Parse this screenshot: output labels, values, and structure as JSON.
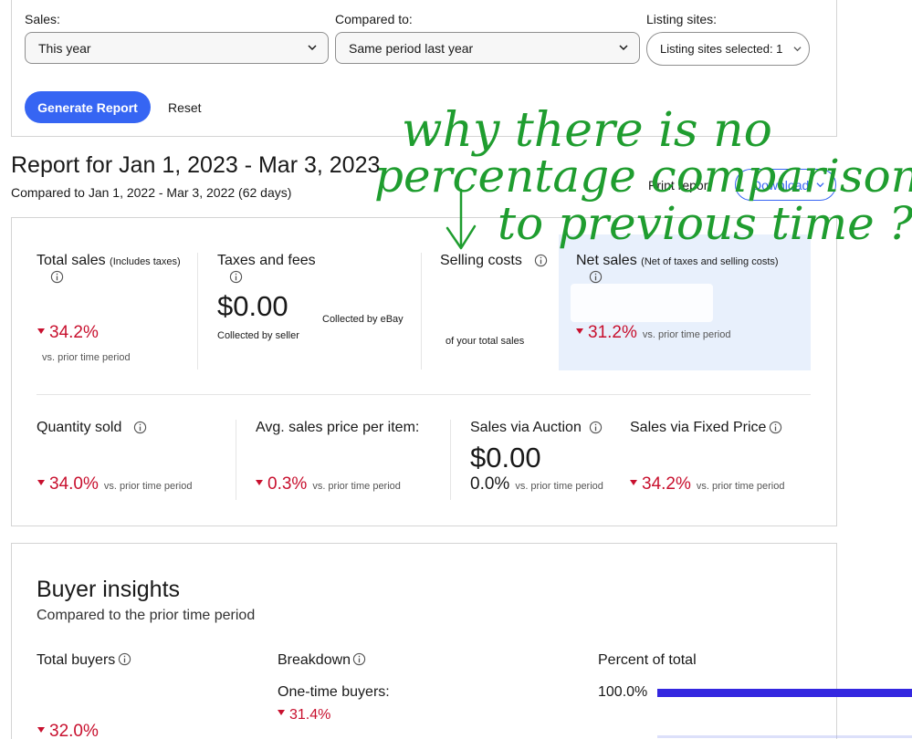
{
  "filters": {
    "sales_label": "Sales:",
    "sales_value": "This year",
    "compared_label": "Compared to:",
    "compared_value": "Same period last year",
    "sites_label": "Listing sites:",
    "sites_value": "Listing sites selected: 1",
    "generate_label": "Generate Report",
    "reset_label": "Reset"
  },
  "report": {
    "title": "Report for Jan 1, 2023 - Mar 3, 2023",
    "compared": "Compared to Jan 1, 2022 - Mar 3, 2022 (62 days)",
    "print_label": "Print report",
    "download_label": "Download"
  },
  "summary": {
    "total_sales": {
      "title": "Total sales",
      "note": "(Includes taxes)",
      "change": "34.2%",
      "vs": "vs. prior time period"
    },
    "taxes": {
      "title": "Taxes and fees",
      "value": "$0.00",
      "collected_ebay": "Collected by eBay",
      "collected_seller": "Collected by seller"
    },
    "selling_costs": {
      "title": "Selling costs",
      "of_total": "of your total sales"
    },
    "net_sales": {
      "title": "Net sales",
      "note": "(Net of taxes and selling costs)",
      "change": "31.2%",
      "vs": "vs. prior time period"
    }
  },
  "secondary": {
    "quantity": {
      "title": "Quantity sold",
      "change": "34.0%",
      "vs": "vs. prior time period"
    },
    "avg_price": {
      "title": "Avg. sales price per item:",
      "change": "0.3%",
      "vs": "vs. prior time period"
    },
    "auction": {
      "title": "Sales via Auction",
      "value": "$0.00",
      "change": "0.0%",
      "vs": "vs. prior time period"
    },
    "fixed": {
      "title": "Sales via Fixed Price",
      "change": "34.2%",
      "vs": "vs. prior time period"
    }
  },
  "buyers": {
    "title": "Buyer insights",
    "subtitle": "Compared to the prior time period",
    "total_buyers": "Total buyers",
    "total_change": "32.0%",
    "breakdown": "Breakdown",
    "one_time": "One-time buyers:",
    "one_time_change": "31.4%",
    "percent_total": "Percent of total",
    "pct_one_time": "100.0%",
    "pct_one_time_fraction": 1.0,
    "repeat_fraction": 0.0
  },
  "annotation": {
    "line1": "why there is no",
    "line2": "percentage comparison",
    "line3": "to previous time ?"
  },
  "colors": {
    "accent": "#3665f3",
    "negative": "#c8102e",
    "bar": "#3427e0",
    "ink": "#1f9d2f"
  }
}
